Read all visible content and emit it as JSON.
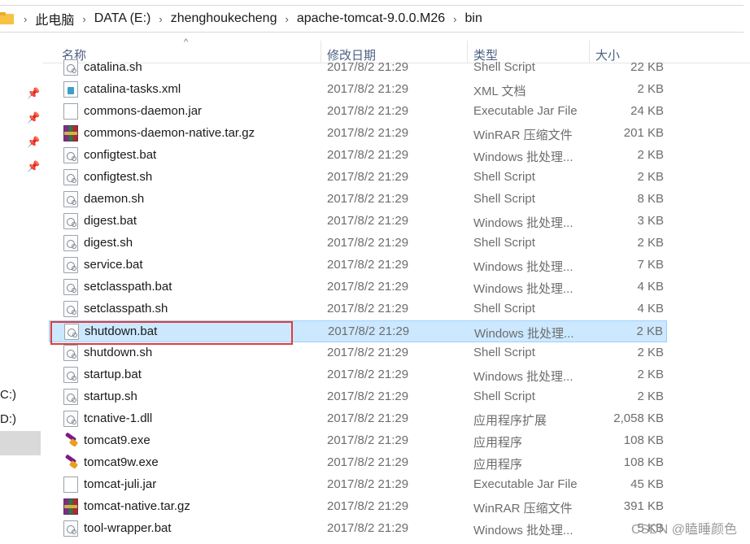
{
  "breadcrumb": [
    "此电脑",
    "DATA (E:)",
    "zhenghoukecheng",
    "apache-tomcat-9.0.0.M26",
    "bin"
  ],
  "nav": {
    "drives": [
      "C:)",
      "D:)"
    ]
  },
  "columns": {
    "name": "名称",
    "date": "修改日期",
    "type": "类型",
    "size": "大小"
  },
  "files": [
    {
      "name": "catalina.sh",
      "date": "2017/8/2 21:29",
      "type": "Shell Script",
      "size": "22 KB",
      "icon": "script-file-icon"
    },
    {
      "name": "catalina-tasks.xml",
      "date": "2017/8/2 21:29",
      "type": "XML 文档",
      "size": "2 KB",
      "icon": "xml-file-icon"
    },
    {
      "name": "commons-daemon.jar",
      "date": "2017/8/2 21:29",
      "type": "Executable Jar File",
      "size": "24 KB",
      "icon": "blank-file-icon"
    },
    {
      "name": "commons-daemon-native.tar.gz",
      "date": "2017/8/2 21:29",
      "type": "WinRAR 压缩文件",
      "size": "201 KB",
      "icon": "rar-file-icon"
    },
    {
      "name": "configtest.bat",
      "date": "2017/8/2 21:29",
      "type": "Windows 批处理...",
      "size": "2 KB",
      "icon": "script-file-icon"
    },
    {
      "name": "configtest.sh",
      "date": "2017/8/2 21:29",
      "type": "Shell Script",
      "size": "2 KB",
      "icon": "script-file-icon"
    },
    {
      "name": "daemon.sh",
      "date": "2017/8/2 21:29",
      "type": "Shell Script",
      "size": "8 KB",
      "icon": "script-file-icon"
    },
    {
      "name": "digest.bat",
      "date": "2017/8/2 21:29",
      "type": "Windows 批处理...",
      "size": "3 KB",
      "icon": "script-file-icon"
    },
    {
      "name": "digest.sh",
      "date": "2017/8/2 21:29",
      "type": "Shell Script",
      "size": "2 KB",
      "icon": "script-file-icon"
    },
    {
      "name": "service.bat",
      "date": "2017/8/2 21:29",
      "type": "Windows 批处理...",
      "size": "7 KB",
      "icon": "script-file-icon"
    },
    {
      "name": "setclasspath.bat",
      "date": "2017/8/2 21:29",
      "type": "Windows 批处理...",
      "size": "4 KB",
      "icon": "script-file-icon"
    },
    {
      "name": "setclasspath.sh",
      "date": "2017/8/2 21:29",
      "type": "Shell Script",
      "size": "4 KB",
      "icon": "script-file-icon"
    },
    {
      "name": "shutdown.bat",
      "date": "2017/8/2 21:29",
      "type": "Windows 批处理...",
      "size": "2 KB",
      "icon": "script-file-icon",
      "selected": true
    },
    {
      "name": "shutdown.sh",
      "date": "2017/8/2 21:29",
      "type": "Shell Script",
      "size": "2 KB",
      "icon": "script-file-icon"
    },
    {
      "name": "startup.bat",
      "date": "2017/8/2 21:29",
      "type": "Windows 批处理...",
      "size": "2 KB",
      "icon": "script-file-icon"
    },
    {
      "name": "startup.sh",
      "date": "2017/8/2 21:29",
      "type": "Shell Script",
      "size": "2 KB",
      "icon": "script-file-icon"
    },
    {
      "name": "tcnative-1.dll",
      "date": "2017/8/2 21:29",
      "type": "应用程序扩展",
      "size": "2,058 KB",
      "icon": "dll-file-icon"
    },
    {
      "name": "tomcat9.exe",
      "date": "2017/8/2 21:29",
      "type": "应用程序",
      "size": "108 KB",
      "icon": "tomcat-exe-icon"
    },
    {
      "name": "tomcat9w.exe",
      "date": "2017/8/2 21:29",
      "type": "应用程序",
      "size": "108 KB",
      "icon": "tomcat-exe-icon"
    },
    {
      "name": "tomcat-juli.jar",
      "date": "2017/8/2 21:29",
      "type": "Executable Jar File",
      "size": "45 KB",
      "icon": "blank-file-icon"
    },
    {
      "name": "tomcat-native.tar.gz",
      "date": "2017/8/2 21:29",
      "type": "WinRAR 压缩文件",
      "size": "391 KB",
      "icon": "rar-file-icon"
    },
    {
      "name": "tool-wrapper.bat",
      "date": "2017/8/2 21:29",
      "type": "Windows 批处理...",
      "size": "5 KB",
      "icon": "script-file-icon"
    }
  ],
  "watermark": "CSDN @瞌睡颜色"
}
